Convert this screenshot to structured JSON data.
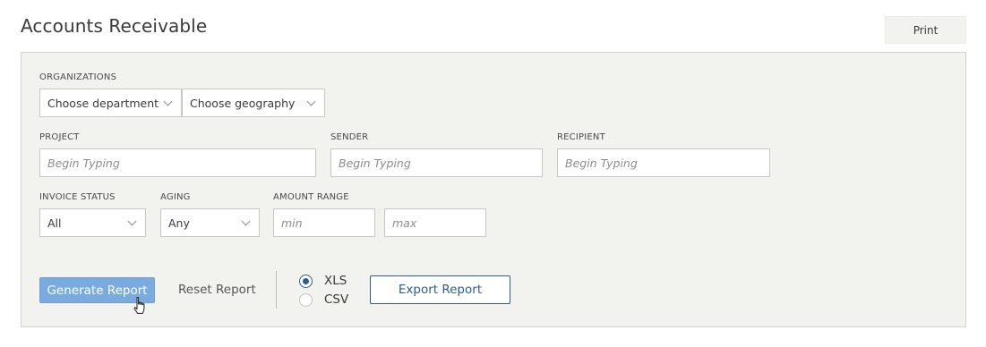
{
  "header": {
    "title": "Accounts Receivable",
    "print_label": "Print"
  },
  "filters": {
    "organizations": {
      "label": "ORGANIZATIONS",
      "department_value": "Choose department",
      "geography_value": "Choose geography"
    },
    "project": {
      "label": "PROJECT",
      "placeholder": "Begin Typing"
    },
    "sender": {
      "label": "SENDER",
      "placeholder": "Begin Typing"
    },
    "recipient": {
      "label": "RECIPIENT",
      "placeholder": "Begin Typing"
    },
    "invoice_status": {
      "label": "INVOICE STATUS",
      "value": "All"
    },
    "aging": {
      "label": "AGING",
      "value": "Any"
    },
    "amount_range": {
      "label": "AMOUNT RANGE",
      "min_placeholder": "min",
      "max_placeholder": "max"
    }
  },
  "actions": {
    "generate_label": "Generate Report",
    "reset_label": "Reset Report",
    "export_label": "Export Report",
    "formats": [
      {
        "label": "XLS",
        "selected": true
      },
      {
        "label": "CSV",
        "selected": false
      }
    ]
  },
  "colors": {
    "panel_bg": "#f2f2ee",
    "primary_button": "#7aabe0",
    "accent": "#2e5c8e"
  },
  "icons": {
    "dropdown": "chevron-down-icon",
    "cursor": "hand-pointer-icon"
  }
}
